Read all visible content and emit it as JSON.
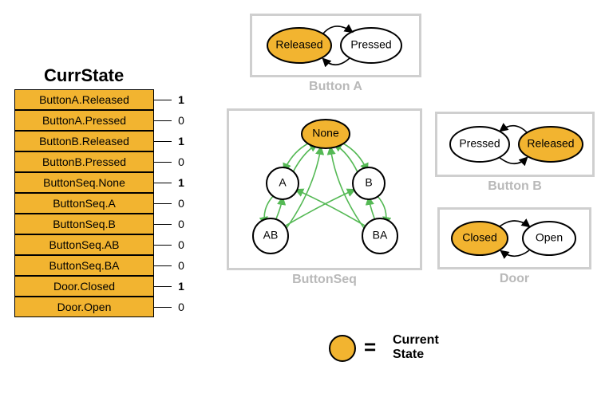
{
  "table": {
    "title": "CurrState",
    "rows": [
      {
        "label": "ButtonA.Released",
        "value": "1",
        "bold": true
      },
      {
        "label": "ButtonA.Pressed",
        "value": "0",
        "bold": false
      },
      {
        "label": "ButtonB.Released",
        "value": "1",
        "bold": true
      },
      {
        "label": "ButtonB.Pressed",
        "value": "0",
        "bold": false
      },
      {
        "label": "ButtonSeq.None",
        "value": "1",
        "bold": true
      },
      {
        "label": "ButtonSeq.A",
        "value": "0",
        "bold": false
      },
      {
        "label": "ButtonSeq.B",
        "value": "0",
        "bold": false
      },
      {
        "label": "ButtonSeq.AB",
        "value": "0",
        "bold": false
      },
      {
        "label": "ButtonSeq.BA",
        "value": "0",
        "bold": false
      },
      {
        "label": "Door.Closed",
        "value": "1",
        "bold": true
      },
      {
        "label": "Door.Open",
        "value": "0",
        "bold": false
      }
    ]
  },
  "fsm": {
    "buttonA": {
      "label": "Button A",
      "states": {
        "released": "Released",
        "pressed": "Pressed"
      },
      "active": "released"
    },
    "buttonB": {
      "label": "Button B",
      "states": {
        "pressed": "Pressed",
        "released": "Released"
      },
      "active": "released"
    },
    "door": {
      "label": "Door",
      "states": {
        "closed": "Closed",
        "open": "Open"
      },
      "active": "closed"
    },
    "seq": {
      "label": "ButtonSeq",
      "states": {
        "none": "None",
        "a": "A",
        "b": "B",
        "ab": "AB",
        "ba": "BA"
      },
      "active": "none"
    }
  },
  "legend": {
    "eq": "=",
    "text1": "Current",
    "text2": "State"
  }
}
